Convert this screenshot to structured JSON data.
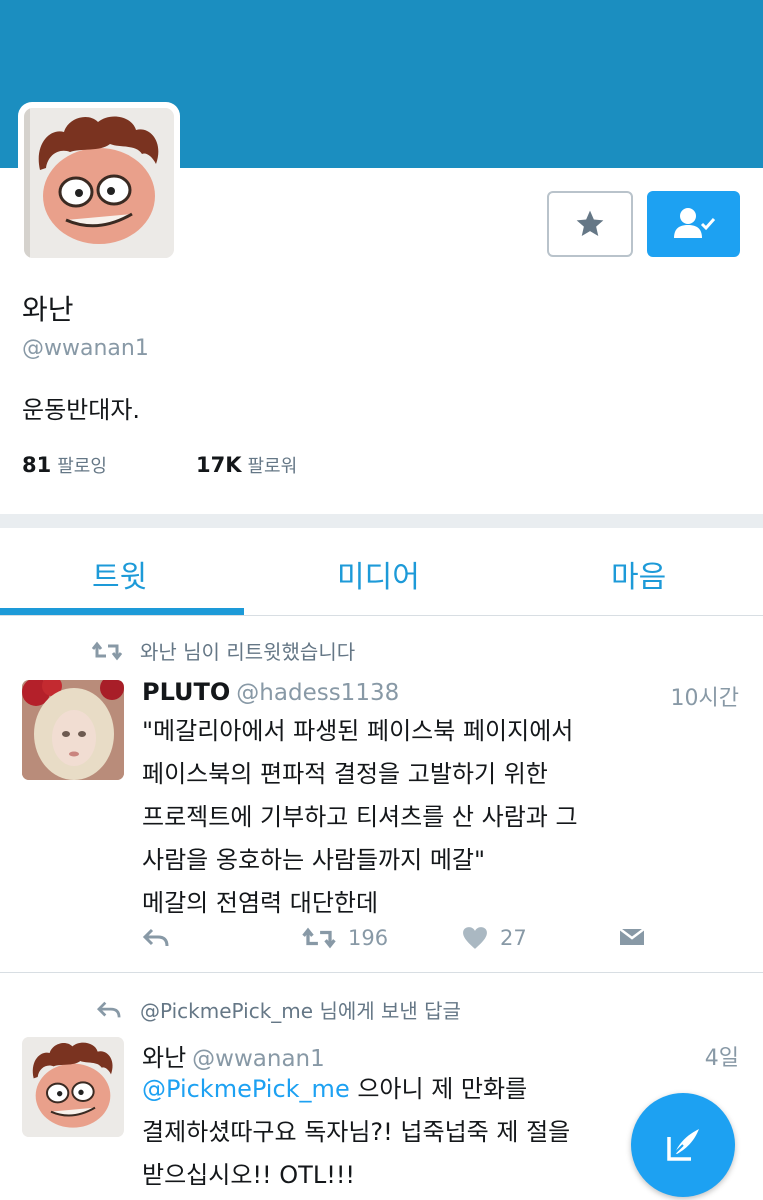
{
  "profile": {
    "display_name": "와난",
    "handle": "@wwanan1",
    "bio": "운동반대자.",
    "following_count": "81",
    "following_label": "팔로잉",
    "followers_count": "17K",
    "followers_label": "팔로워"
  },
  "header": {
    "banner_color": "#1b8ec0",
    "accent_color": "#1da1f2"
  },
  "actions_top": {
    "favorite_icon": "star-icon",
    "follow_icon": "person-check-icon"
  },
  "tabs": [
    {
      "label": "트윗",
      "active": true
    },
    {
      "label": "미디어",
      "active": false
    },
    {
      "label": "마음",
      "active": false
    }
  ],
  "timeline": [
    {
      "context": "와난 님이 리트윗했습니다",
      "context_icon": "retweet-icon",
      "author_name": "PLUTO",
      "author_handle": "@hadess1138",
      "time": "10시간",
      "lines": [
        "\"메갈리아에서 파생된 페이스북 페이지에서",
        "페이스북의 편파적 결정을 고발하기 위한",
        "프로젝트에 기부하고 티셔츠를 산 사람과 그",
        "사람을 옹호하는 사람들까지 메갈\"",
        "메갈의 전염력 대단한데"
      ],
      "retweets": "196",
      "likes": "27"
    },
    {
      "context": "@PickmePick_me 님에게 보낸 답글",
      "context_icon": "reply-icon",
      "author_name": "와난",
      "author_handle": "@wwanan1",
      "time": "4일",
      "mention": "@PickmePick_me",
      "line1_rest": " 으아니 제 만화를",
      "line2": "결제하셨따구요 독자님?! 넙죽넙죽 제 절을",
      "line3": "받으십시오!! OTL!!!"
    }
  ],
  "fab": {
    "icon": "compose-icon"
  }
}
